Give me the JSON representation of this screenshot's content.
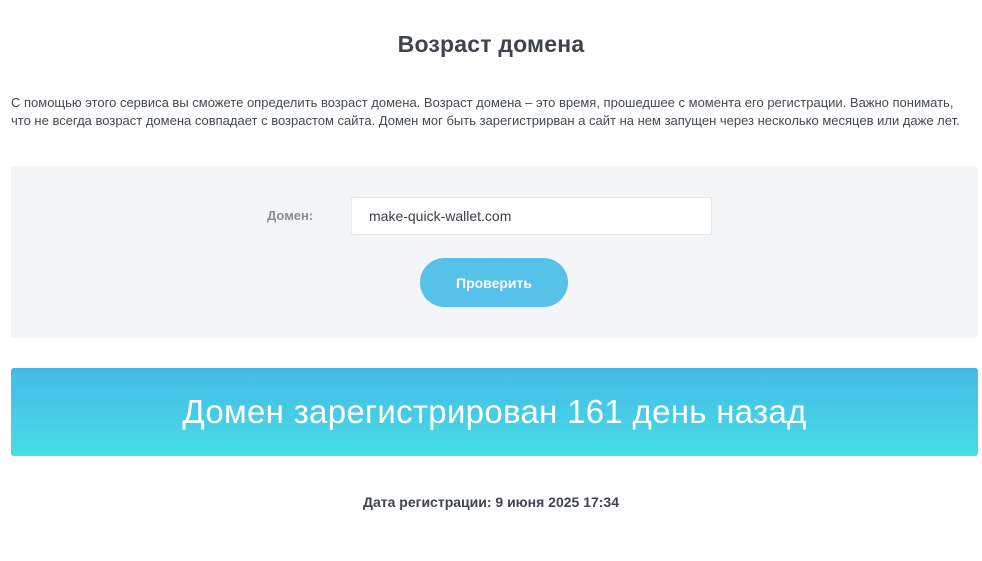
{
  "page": {
    "title": "Возраст домена",
    "intro": "С помощью этого сервиса вы сможете определить возраст домена. Возраст домена – это время, прошедшее с момента его регистрации. Важно понимать, что не всегда возраст домена совпадает с возрастом сайта. Домен мог быть зарегистрирван а сайт на нем запущен через несколько месяцев или даже лет."
  },
  "form": {
    "domain_label": "Домен:",
    "domain_value": "make-quick-wallet.com",
    "submit_label": "Проверить"
  },
  "result": {
    "message": "Домен зарегистрирован 161 день назад",
    "registration_date": "Дата регистрации: 9 июня 2025 17:34"
  },
  "colors": {
    "button": "#56c2ea",
    "banner_top": "#46b9e6",
    "banner_bottom": "#47dde6",
    "panel": "#f3f5f6"
  }
}
